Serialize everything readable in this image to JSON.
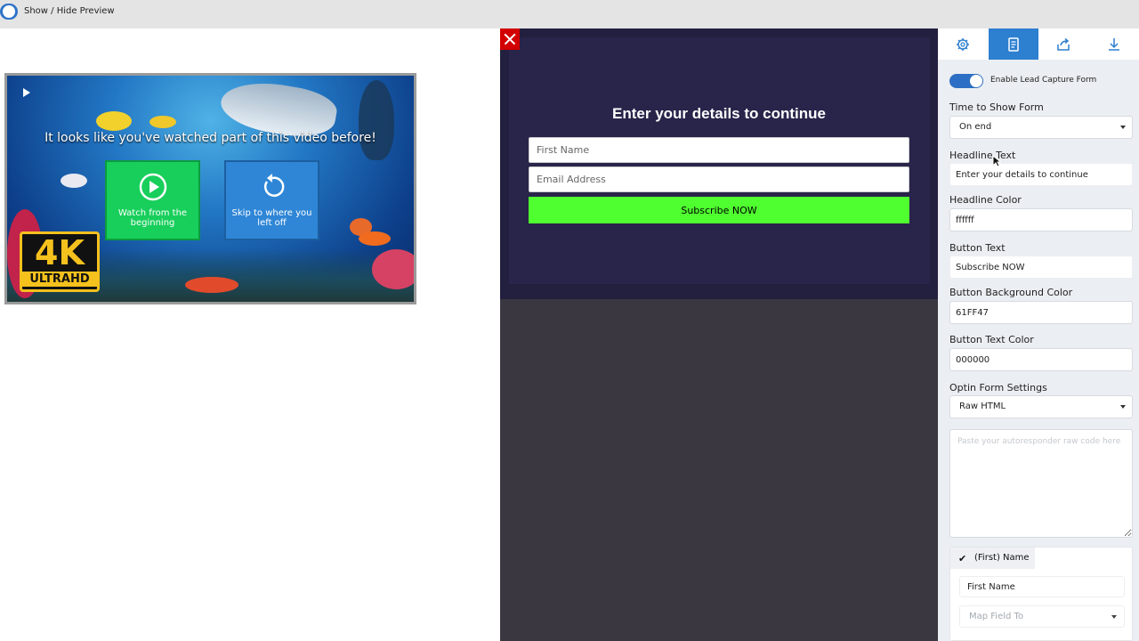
{
  "topbar": {
    "toggle_label": "Show / Hide Preview"
  },
  "video": {
    "message": "It looks like you've watched part of this video before!",
    "watch_label": "Watch from the beginning",
    "skip_label": "Skip to where you left off",
    "badge_big": "4K",
    "badge_small": "ULTRAHD"
  },
  "form_preview": {
    "headline": "Enter your details to continue",
    "first_name_placeholder": "First Name",
    "email_placeholder": "Email Address",
    "button_label": "Subscribe NOW",
    "button_bg": "#4FFF2F",
    "button_text_color": "#000000",
    "headline_color": "#ffffff"
  },
  "panel": {
    "tabs": [
      {
        "name": "settings",
        "icon": "gear-icon"
      },
      {
        "name": "lead-form",
        "icon": "form-icon",
        "active": true
      },
      {
        "name": "share",
        "icon": "share-icon"
      },
      {
        "name": "download",
        "icon": "download-icon"
      }
    ],
    "enable_label": "Enable Lead Capture Form",
    "time_label": "Time to Show Form",
    "time_value": "On end",
    "headline_text_label": "Headline Text",
    "headline_text_value": "Enter your details to continue",
    "headline_color_label": "Headline Color",
    "headline_color_value": "ffffff",
    "button_text_label": "Button Text",
    "button_text_value": "Subscribe NOW",
    "button_bg_label": "Button Background Color",
    "button_bg_value": "61FF47",
    "button_text_color_label": "Button Text Color",
    "button_text_color_value": "000000",
    "optin_label": "Optin Form Settings",
    "optin_value": "Raw HTML",
    "raw_code_placeholder": "Paste your autoresponder raw code here",
    "field_card": {
      "chip_label": "(First) Name",
      "name_value": "First Name",
      "map_placeholder": "Map Field To"
    }
  }
}
